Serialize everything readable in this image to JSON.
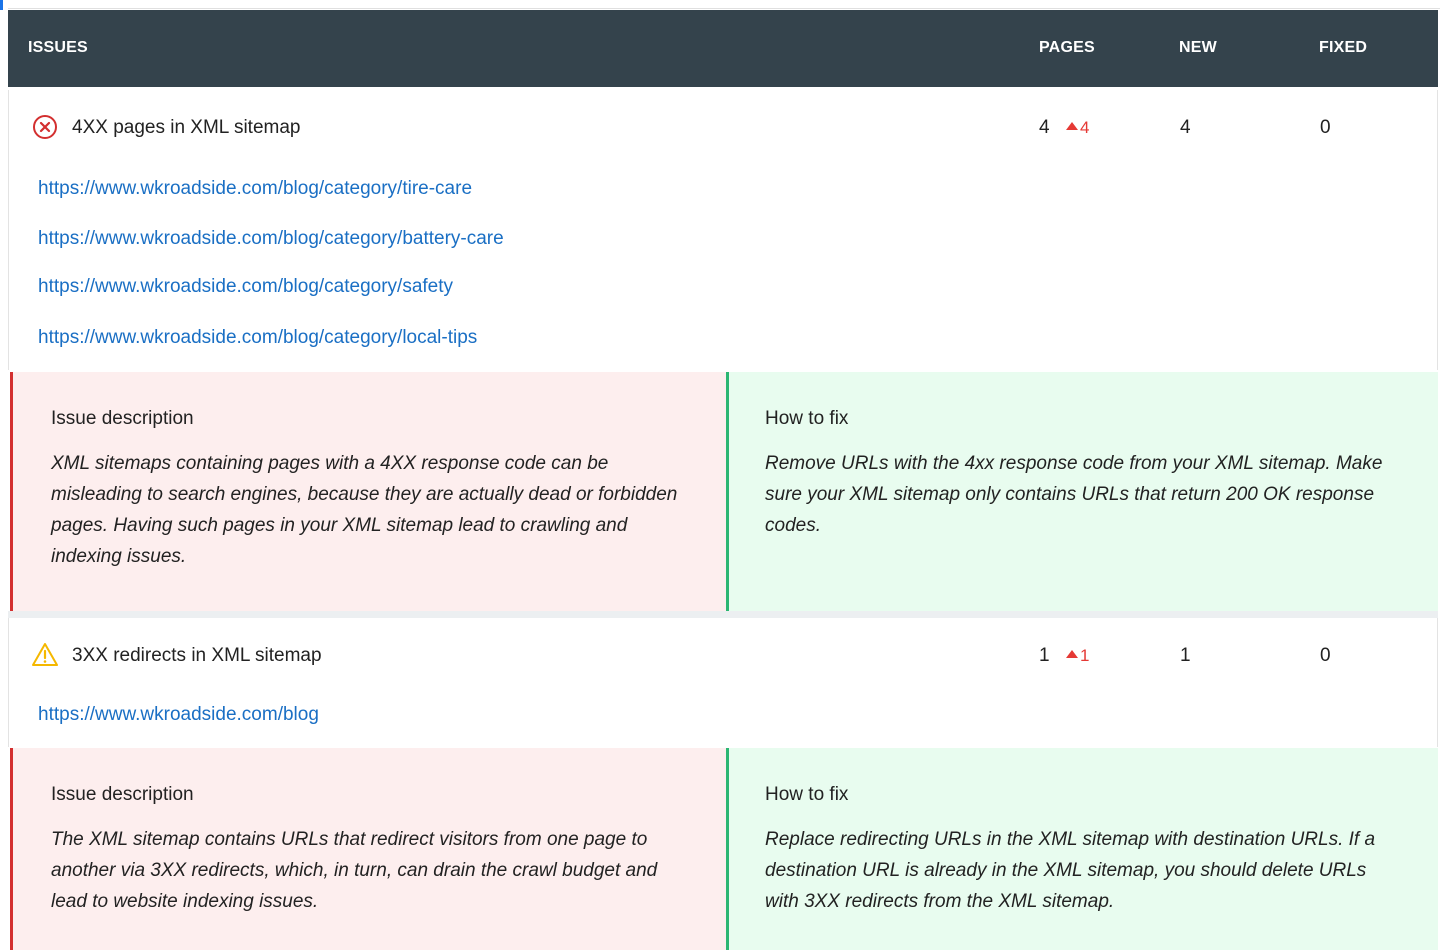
{
  "header": {
    "issues": "ISSUES",
    "pages": "PAGES",
    "new": "NEW",
    "fixed": "FIXED"
  },
  "issues": [
    {
      "severity": "error",
      "icon": "error-circle-x-icon",
      "title": "4XX pages in XML sitemap",
      "pages": "4",
      "pages_delta": "4",
      "new": "4",
      "fixed": "0",
      "urls": [
        "https://www.wkroadside.com/blog/category/tire-care",
        "https://www.wkroadside.com/blog/category/battery-care",
        "https://www.wkroadside.com/blog/category/safety",
        "https://www.wkroadside.com/blog/category/local-tips"
      ],
      "description_title": "Issue description",
      "description": "XML sitemaps containing pages with a 4XX response code can be misleading to search engines, because they are actually dead or forbidden pages. Having such pages in your XML sitemap lead to crawling and indexing issues.",
      "fix_title": "How to fix",
      "fix": "Remove URLs with the 4xx response code from your XML sitemap. Make sure your XML sitemap only contains URLs that return 200 OK response codes."
    },
    {
      "severity": "warning",
      "icon": "warning-triangle-icon",
      "title": "3XX redirects in XML sitemap",
      "pages": "1",
      "pages_delta": "1",
      "new": "1",
      "fixed": "0",
      "urls": [
        "https://www.wkroadside.com/blog"
      ],
      "description_title": "Issue description",
      "description": "The XML sitemap contains URLs that redirect visitors from one page to another via 3XX redirects, which, in turn, can drain the crawl budget and lead to website indexing issues.",
      "fix_title": "How to fix",
      "fix": "Replace redirecting URLs in the XML sitemap with destination URLs. If a destination URL is already in the XML sitemap, you should delete URLs with 3XX redirects from the XML sitemap."
    }
  ],
  "colors": {
    "header_bg": "#34434c",
    "link": "#1a6fc4",
    "error": "#d32f2f",
    "warning": "#f5b800",
    "delta": "#e53935",
    "desc_bg": "#fdeeee",
    "fix_bg": "#e8fcef",
    "fix_border": "#2bb673"
  }
}
